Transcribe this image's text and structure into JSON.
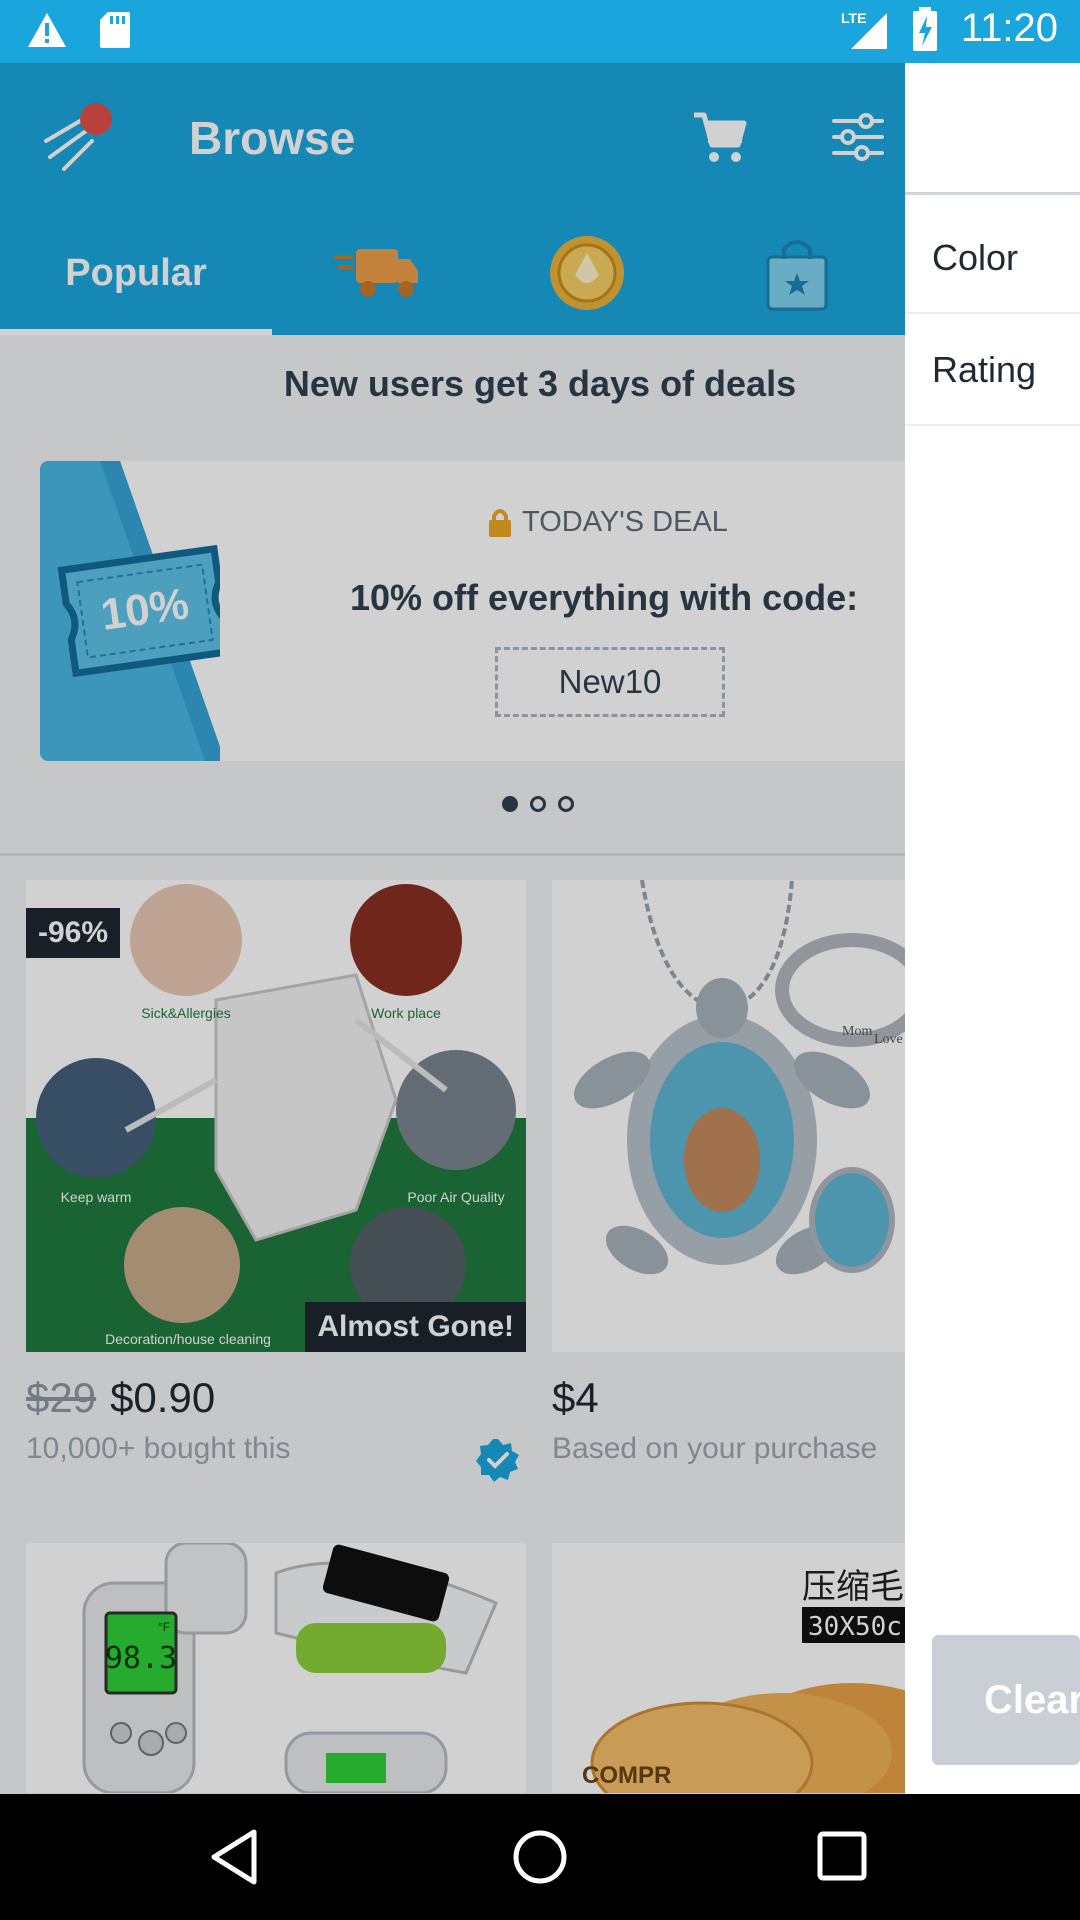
{
  "status_bar": {
    "time": "11:20",
    "network": "LTE",
    "icons": [
      "warning-icon",
      "sd-card-icon",
      "lte-signal-icon",
      "battery-charging-icon"
    ]
  },
  "toolbar": {
    "title": "Browse",
    "icons": [
      "app-logo-icon",
      "cart-icon",
      "filter-icon"
    ]
  },
  "tabs": [
    {
      "label": "Popular",
      "selected": true
    },
    {
      "icon": "fast-delivery-icon"
    },
    {
      "icon": "gold-coin-icon"
    },
    {
      "icon": "shopping-bag-star-icon"
    }
  ],
  "promo": {
    "headline": "New users get 3 days of deals",
    "coupon_text": "10%",
    "deal_label": "TODAY'S DEAL",
    "deal_text": "10% off everything with code:",
    "code": "New10",
    "carousel_pages": 3,
    "carousel_active": 1
  },
  "products": [
    {
      "discount_badge": "-96%",
      "status_badge": "Almost Gone!",
      "old_price": "$29",
      "price": "$0.90",
      "subtext": "10,000+ bought this",
      "verified": true,
      "image_labels": [
        "Sick&Allergies",
        "Work place",
        "Keep warm",
        "Poor Air Quality",
        "Decoration/house cleaning"
      ]
    },
    {
      "price": "$4",
      "subtext": "Based on your purchase",
      "image_labels": [
        "Mom",
        "Love"
      ]
    },
    {
      "image_labels": [
        "98.3",
        "°F"
      ]
    },
    {
      "image_labels": [
        "压缩毛",
        "30X50c",
        "COMPR"
      ]
    }
  ],
  "drawer": {
    "items": [
      "Color",
      "Rating"
    ],
    "clear_button": "Clear"
  },
  "colors": {
    "brand_blue": "#1aa6dd",
    "text_dark": "#2f4150",
    "badge_dark": "#1e272f"
  },
  "nav_bar": [
    "back-icon",
    "home-icon",
    "recents-icon"
  ]
}
